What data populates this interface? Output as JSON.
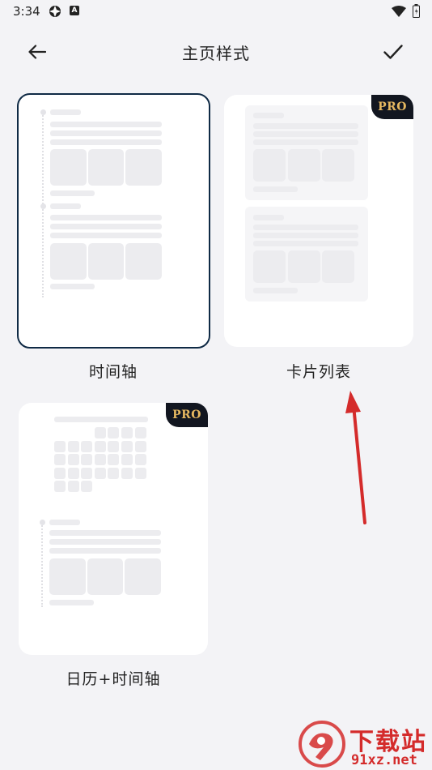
{
  "status_bar": {
    "time": "3:34",
    "badge_letter": "A"
  },
  "header": {
    "title": "主页样式"
  },
  "styles": [
    {
      "label": "时间轴",
      "selected": true,
      "pro": false
    },
    {
      "label": "卡片列表",
      "selected": false,
      "pro": true,
      "pro_label": "PRO"
    },
    {
      "label": "日历+时间轴",
      "selected": false,
      "pro": true,
      "pro_label": "PRO"
    }
  ],
  "watermark": {
    "title": "下载站",
    "url": "91xz.net"
  },
  "colors": {
    "background": "#f3f3f6",
    "selected_border": "#0f2a45",
    "pro_badge_bg": "#121620",
    "pro_badge_text": "#e6b860",
    "annotation_arrow": "#d42b2b"
  }
}
